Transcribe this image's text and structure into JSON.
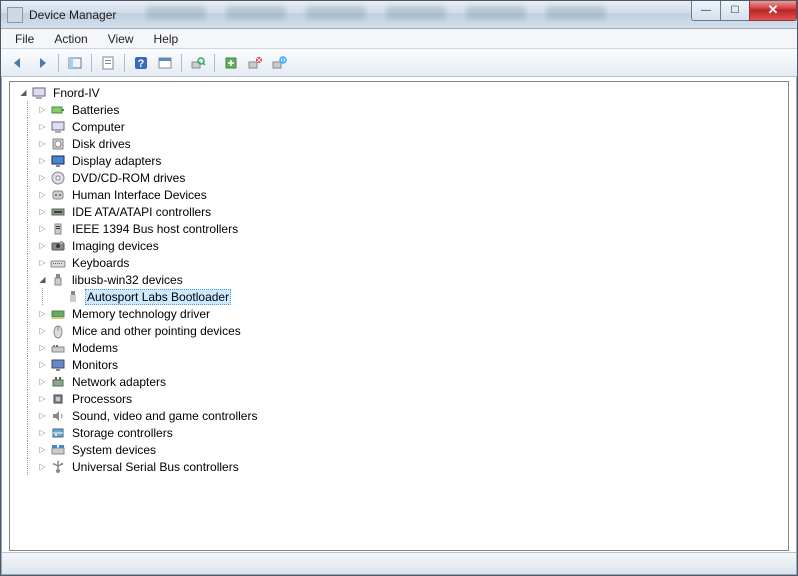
{
  "window": {
    "title": "Device Manager"
  },
  "menu": {
    "file": "File",
    "action": "Action",
    "view": "View",
    "help": "Help"
  },
  "toolbar": {
    "back": "Back",
    "forward": "Forward",
    "show_hide": "Show/Hide Console Tree",
    "properties": "Properties",
    "help": "Help",
    "action_menu": "Action",
    "scan": "Scan for hardware changes",
    "update": "Update Driver Software",
    "uninstall": "Uninstall",
    "disable": "Disable"
  },
  "tree": {
    "root": "Fnord-IV",
    "nodes": [
      {
        "label": "Batteries",
        "icon": "battery"
      },
      {
        "label": "Computer",
        "icon": "computer"
      },
      {
        "label": "Disk drives",
        "icon": "disk"
      },
      {
        "label": "Display adapters",
        "icon": "display"
      },
      {
        "label": "DVD/CD-ROM drives",
        "icon": "cdrom"
      },
      {
        "label": "Human Interface Devices",
        "icon": "hid"
      },
      {
        "label": "IDE ATA/ATAPI controllers",
        "icon": "ide"
      },
      {
        "label": "IEEE 1394 Bus host controllers",
        "icon": "ieee1394"
      },
      {
        "label": "Imaging devices",
        "icon": "imaging"
      },
      {
        "label": "Keyboards",
        "icon": "keyboard"
      },
      {
        "label": "libusb-win32 devices",
        "icon": "usb",
        "expanded": true,
        "children": [
          {
            "label": "Autosport Labs Bootloader",
            "icon": "usb-device",
            "selected": true
          }
        ]
      },
      {
        "label": "Memory technology driver",
        "icon": "memory"
      },
      {
        "label": "Mice and other pointing devices",
        "icon": "mouse"
      },
      {
        "label": "Modems",
        "icon": "modem"
      },
      {
        "label": "Monitors",
        "icon": "monitor"
      },
      {
        "label": "Network adapters",
        "icon": "network"
      },
      {
        "label": "Processors",
        "icon": "processor"
      },
      {
        "label": "Sound, video and game controllers",
        "icon": "sound"
      },
      {
        "label": "Storage controllers",
        "icon": "storage"
      },
      {
        "label": "System devices",
        "icon": "system"
      },
      {
        "label": "Universal Serial Bus controllers",
        "icon": "usb-controller"
      }
    ]
  }
}
